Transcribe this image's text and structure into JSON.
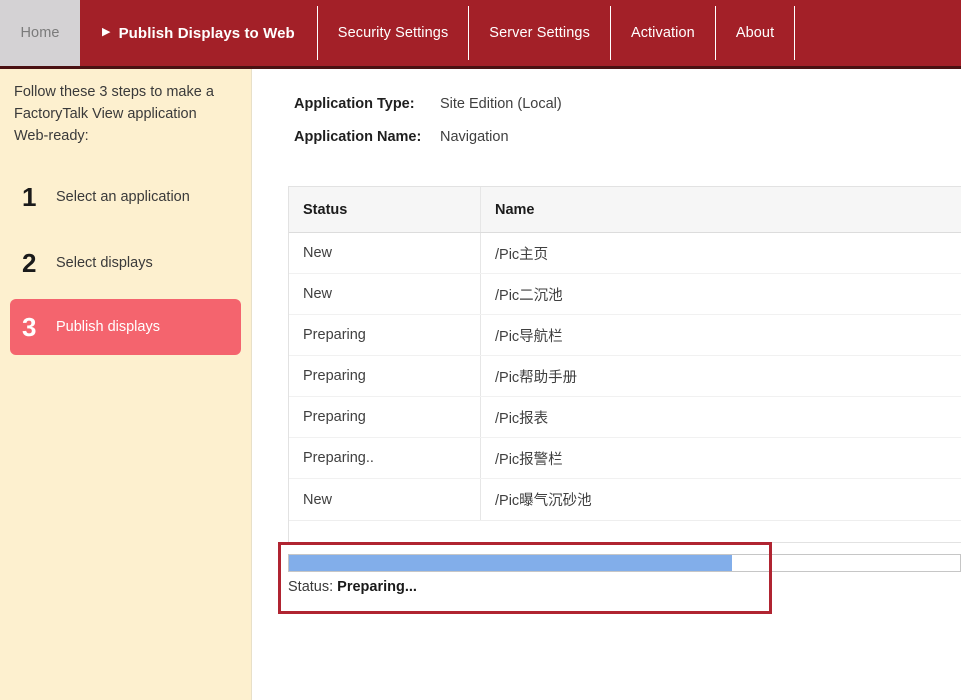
{
  "colors": {
    "nav_red": "#a32028",
    "nav_underline": "#4a1112",
    "home_tab_bg": "#d4d2d4",
    "sidebar_bg": "#fdf0cf",
    "step_active_bg": "#f4646e",
    "progress_fill": "#82aeea",
    "annotation_red": "#b02431",
    "table_header_bg": "#f6f6f6"
  },
  "topnav": {
    "home": {
      "label": "Home",
      "icon": "home-tab"
    },
    "tabs": [
      {
        "label": "Publish Displays to Web",
        "marker": "▶",
        "active": true
      },
      {
        "label": "Security Settings",
        "active": false
      },
      {
        "label": "Server Settings",
        "active": false
      },
      {
        "label": "Activation",
        "active": false
      },
      {
        "label": "About",
        "active": false
      }
    ]
  },
  "sidebar": {
    "intro": "Follow these 3 steps to make a FactoryTalk View application Web-ready:",
    "steps": [
      {
        "number": "1",
        "label": "Select an application",
        "current": false
      },
      {
        "number": "2",
        "label": "Select displays",
        "current": false
      },
      {
        "number": "3",
        "label": "Publish displays",
        "current": true
      }
    ]
  },
  "main": {
    "app_info": [
      {
        "label": "Application Type:",
        "value": "Site Edition (Local)"
      },
      {
        "label": "Application Name:",
        "value": "Navigation"
      }
    ],
    "table": {
      "columns": [
        "Status",
        "Name"
      ],
      "rows": [
        {
          "status": "New",
          "name": "/Pic主页"
        },
        {
          "status": "New",
          "name": "/Pic二沉池"
        },
        {
          "status": "Preparing",
          "name": "/Pic导航栏"
        },
        {
          "status": "Preparing",
          "name": "/Pic帮助手册"
        },
        {
          "status": "Preparing",
          "name": "/Pic报表"
        },
        {
          "status": "Preparing..",
          "name": "/Pic报警栏"
        },
        {
          "status": "New",
          "name": "/Pic曝气沉砂池"
        }
      ]
    },
    "progress": {
      "percent": 66,
      "status_label": "Status:",
      "status_value": "Preparing..."
    }
  }
}
